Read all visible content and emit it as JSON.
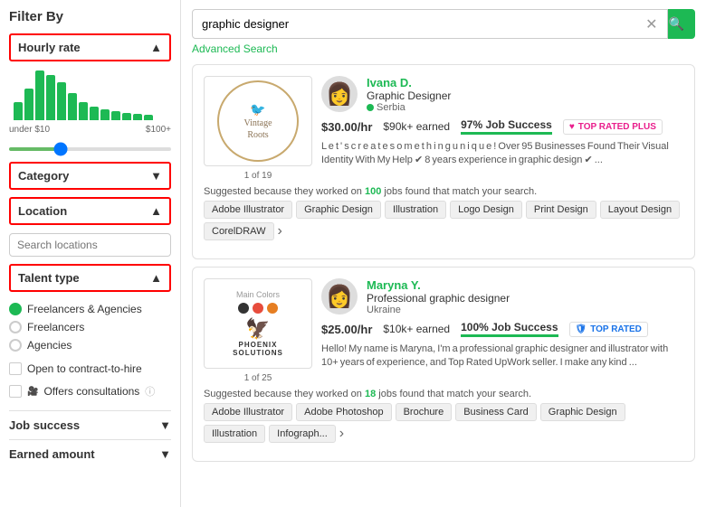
{
  "sidebar": {
    "title": "Filter By",
    "hourly_rate": {
      "label": "Hourly rate",
      "expanded": true,
      "min_label": "under $10",
      "max_label": "$100+"
    },
    "category": {
      "label": "Category",
      "expanded": false
    },
    "location": {
      "label": "Location",
      "expanded": true,
      "search_placeholder": "Search locations"
    },
    "talent_type": {
      "label": "Talent type",
      "expanded": true,
      "options": [
        {
          "label": "Freelancers & Agencies",
          "selected": true
        },
        {
          "label": "Freelancers",
          "selected": false
        },
        {
          "label": "Agencies",
          "selected": false
        }
      ]
    },
    "contract_label": "Open to contract-to-hire",
    "consultations_label": "Offers consultations",
    "job_success": {
      "label": "Job success"
    },
    "earned_amount": {
      "label": "Earned amount"
    }
  },
  "search": {
    "value": "graphic designer",
    "advanced_label": "Advanced Search"
  },
  "freelancers": [
    {
      "id": 1,
      "name": "Ivana D.",
      "title": "Graphic Designer",
      "location": "Serbia",
      "rate": "$30.00/hr",
      "earned": "$90k+ earned",
      "job_success": "97% Job Success",
      "badge": "TOP RATED PLUS",
      "badge_type": "plus",
      "description": "L e t ' s  c r e a t e  s o m e t h i n g  u n i q u e !  Over 95 Businesses Found Their Visual Identity With My Help ✔ 8 years experience in graphic design ✔ ...",
      "counter": "1 of 19",
      "logo_text": "Vintage Roots",
      "tags": [
        "Adobe Illustrator",
        "Graphic Design",
        "Illustration",
        "Logo Design",
        "Print Design",
        "Layout Design",
        "CorelDRAW"
      ],
      "suggested_jobs": "100",
      "suggested_text": "Suggested because they worked on"
    },
    {
      "id": 2,
      "name": "Maryna Y.",
      "title": "Professional graphic designer",
      "location": "Ukraine",
      "rate": "$25.00/hr",
      "earned": "$10k+ earned",
      "job_success": "100% Job Success",
      "badge": "TOP RATED",
      "badge_type": "regular",
      "description": "Hello! My name is Maryna, I'm a professional graphic designer and illustrator with 10+ years of experience, and Top Rated UpWork seller. I make any kind ...",
      "counter": "1 of 25",
      "logo_text": "Phoenix Solutions",
      "tags": [
        "Adobe Illustrator",
        "Adobe Photoshop",
        "Brochure",
        "Business Card",
        "Graphic Design",
        "Illustration",
        "Infograph..."
      ],
      "suggested_jobs": "18",
      "suggested_text": "Suggested because they worked on"
    }
  ]
}
